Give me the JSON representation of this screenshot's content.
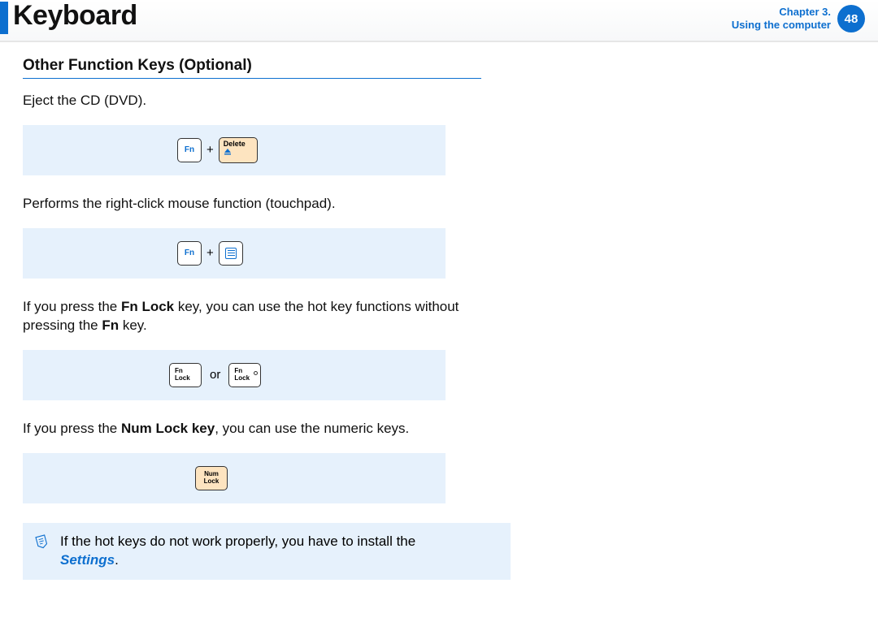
{
  "header": {
    "title": "Keyboard",
    "chapter_line1": "Chapter 3.",
    "chapter_line2": "Using the computer",
    "page": "48"
  },
  "section_title": "Other Function Keys (Optional)",
  "item1": {
    "desc": "Eject the CD (DVD).",
    "fn": "Fn",
    "plus": "+",
    "delete": "Delete"
  },
  "item2": {
    "desc": "Performs the right-click mouse function (touchpad).",
    "fn": "Fn",
    "plus": "+"
  },
  "item3": {
    "desc_pre": "If you press the ",
    "desc_b1": "Fn Lock",
    "desc_mid": " key, you can use the hot key functions without pressing the ",
    "desc_b2": "Fn",
    "desc_post": " key.",
    "fnlock1_l1": "Fn",
    "fnlock1_l2": "Lock",
    "or": "or",
    "fnlock2_l1": "Fn",
    "fnlock2_l2": "Lock"
  },
  "item4": {
    "desc_pre": "If you press the ",
    "desc_b1": "Num Lock key",
    "desc_post": ", you can use the numeric keys.",
    "numlock_l1": "Num",
    "numlock_l2": "Lock"
  },
  "note": {
    "text_pre": "If the hot keys do not work properly, you have to install the ",
    "text_b": "Settings",
    "text_post": "."
  }
}
